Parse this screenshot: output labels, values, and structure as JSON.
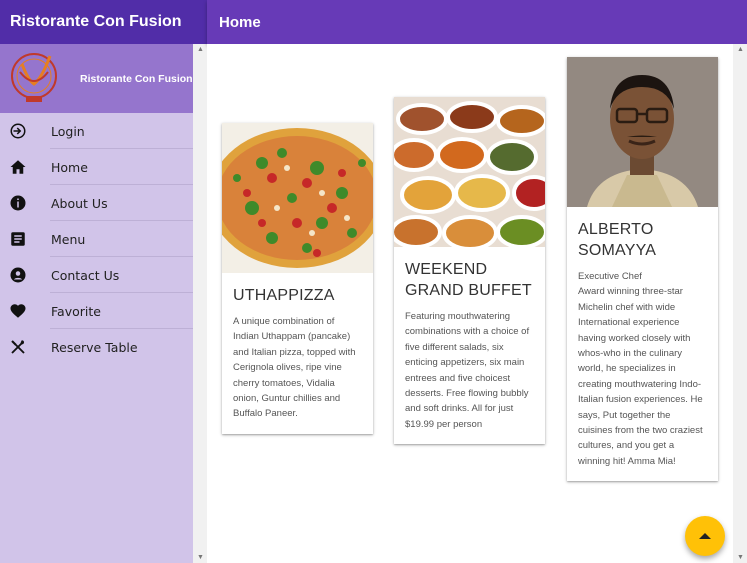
{
  "drawer": {
    "title": "Ristorante Con Fusion",
    "header_title": "Ristorante Con Fusion",
    "items": [
      {
        "label": "Login",
        "icon": "login-icon"
      },
      {
        "label": "Home",
        "icon": "home-icon"
      },
      {
        "label": "About Us",
        "icon": "info-icon"
      },
      {
        "label": "Menu",
        "icon": "menu-list-icon"
      },
      {
        "label": "Contact Us",
        "icon": "contact-icon"
      },
      {
        "label": "Favorite",
        "icon": "heart-icon"
      },
      {
        "label": "Reserve Table",
        "icon": "utensils-icon"
      }
    ]
  },
  "main": {
    "title": "Home",
    "cards": [
      {
        "title": "UTHAPPIZZA",
        "description": "A unique combination of Indian Uthappam (pancake) and Italian pizza, topped with Cerignola olives, ripe vine cherry tomatoes, Vidalia onion, Guntur chillies and Buffalo Paneer."
      },
      {
        "title": "WEEKEND GRAND BUFFET",
        "description": "Featuring mouthwatering combinations with a choice of five different salads, six enticing appetizers, six main entrees and five choicest desserts. Free flowing bubbly and soft drinks. All for just $19.99 per person"
      },
      {
        "title": "ALBERTO SOMAYYA",
        "subtitle": "Executive Chef",
        "description": "Award winning three-star Michelin chef with wide International experience having worked closely with whos-who in the culinary world, he specializes in creating mouthwatering Indo-Italian fusion experiences. He says, Put together the cuisines from the two craziest cultures, and you get a winning hit! Amma Mia!"
      }
    ]
  },
  "colors": {
    "primary": "#673ab7",
    "primary_dark": "#512da8",
    "drawer_bg": "#d1c4e9",
    "header_bg": "#9575cd",
    "accent": "#ffc107"
  },
  "fab_icon": "arrow-up-icon"
}
